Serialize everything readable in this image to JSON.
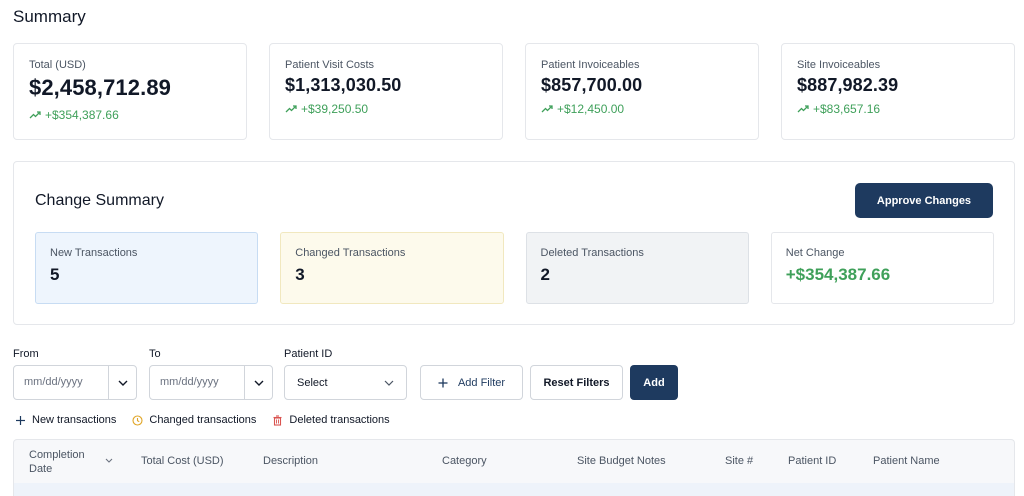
{
  "page": {
    "title": "Summary"
  },
  "cards": [
    {
      "label": "Total (USD)",
      "value": "$2,458,712.89",
      "delta": "+$354,387.66"
    },
    {
      "label": "Patient Visit Costs",
      "value": "$1,313,030.50",
      "delta": "+$39,250.50"
    },
    {
      "label": "Patient Invoiceables",
      "value": "$857,700.00",
      "delta": "+$12,450.00"
    },
    {
      "label": "Site Invoiceables",
      "value": "$887,982.39",
      "delta": "+$83,657.16"
    }
  ],
  "change_summary": {
    "title": "Change Summary",
    "approve_label": "Approve Changes",
    "stats": [
      {
        "label": "New Transactions",
        "value": "5"
      },
      {
        "label": "Changed Transactions",
        "value": "3"
      },
      {
        "label": "Deleted Transactions",
        "value": "2"
      },
      {
        "label": "Net Change",
        "value": "+$354,387.66"
      }
    ]
  },
  "filters": {
    "from_label": "From",
    "to_label": "To",
    "patient_label": "Patient ID",
    "date_placeholder": "mm/dd/yyyy",
    "patient_select_value": "Select",
    "add_filter_label": "Add Filter",
    "reset_label": "Reset Filters",
    "add_label": "Add"
  },
  "legend": {
    "new": "New transactions",
    "changed": "Changed transactions",
    "deleted": "Deleted transactions"
  },
  "table": {
    "columns": [
      "Completion Date",
      "Total Cost (USD)",
      "Description",
      "Category",
      "Site Budget Notes",
      "Site #",
      "Patient ID",
      "Patient Name"
    ]
  },
  "colors": {
    "primary": "#1e3a5f",
    "positive": "#3fa05a",
    "new_bg": "#eef5fd",
    "changed_bg": "#fdfaec",
    "deleted_bg": "#f1f3f5",
    "changed_icon": "#e0a526",
    "deleted_icon": "#d9534f",
    "new_icon": "#1e3a5f"
  },
  "icons": {
    "trend": "trending-up-icon",
    "chevron": "chevron-down-icon",
    "plus": "plus-icon",
    "clock": "clock-icon",
    "trash": "trash-icon",
    "sort": "sort-icon"
  }
}
